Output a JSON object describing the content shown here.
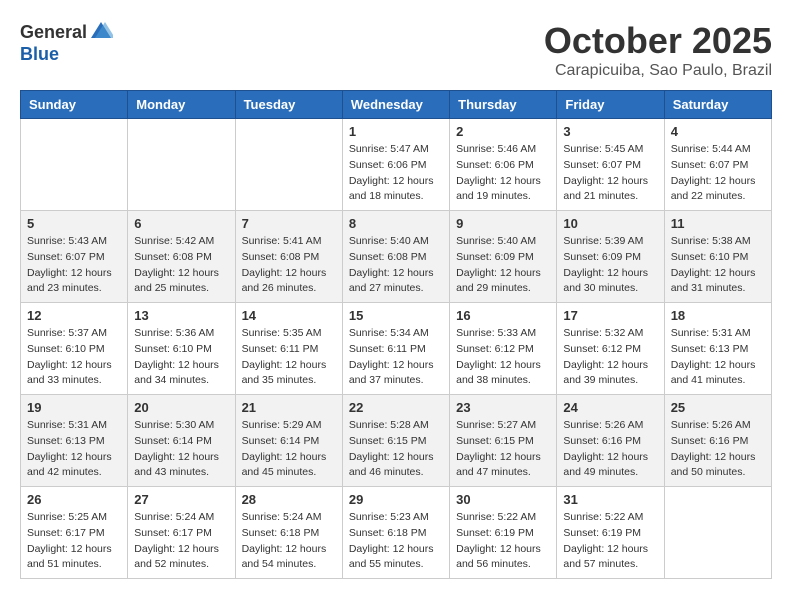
{
  "header": {
    "logo_general": "General",
    "logo_blue": "Blue",
    "month_title": "October 2025",
    "location": "Carapicuiba, Sao Paulo, Brazil"
  },
  "days_of_week": [
    "Sunday",
    "Monday",
    "Tuesday",
    "Wednesday",
    "Thursday",
    "Friday",
    "Saturday"
  ],
  "weeks": [
    [
      {
        "day": "",
        "info": ""
      },
      {
        "day": "",
        "info": ""
      },
      {
        "day": "",
        "info": ""
      },
      {
        "day": "1",
        "info": "Sunrise: 5:47 AM\nSunset: 6:06 PM\nDaylight: 12 hours and 18 minutes."
      },
      {
        "day": "2",
        "info": "Sunrise: 5:46 AM\nSunset: 6:06 PM\nDaylight: 12 hours and 19 minutes."
      },
      {
        "day": "3",
        "info": "Sunrise: 5:45 AM\nSunset: 6:07 PM\nDaylight: 12 hours and 21 minutes."
      },
      {
        "day": "4",
        "info": "Sunrise: 5:44 AM\nSunset: 6:07 PM\nDaylight: 12 hours and 22 minutes."
      }
    ],
    [
      {
        "day": "5",
        "info": "Sunrise: 5:43 AM\nSunset: 6:07 PM\nDaylight: 12 hours and 23 minutes."
      },
      {
        "day": "6",
        "info": "Sunrise: 5:42 AM\nSunset: 6:08 PM\nDaylight: 12 hours and 25 minutes."
      },
      {
        "day": "7",
        "info": "Sunrise: 5:41 AM\nSunset: 6:08 PM\nDaylight: 12 hours and 26 minutes."
      },
      {
        "day": "8",
        "info": "Sunrise: 5:40 AM\nSunset: 6:08 PM\nDaylight: 12 hours and 27 minutes."
      },
      {
        "day": "9",
        "info": "Sunrise: 5:40 AM\nSunset: 6:09 PM\nDaylight: 12 hours and 29 minutes."
      },
      {
        "day": "10",
        "info": "Sunrise: 5:39 AM\nSunset: 6:09 PM\nDaylight: 12 hours and 30 minutes."
      },
      {
        "day": "11",
        "info": "Sunrise: 5:38 AM\nSunset: 6:10 PM\nDaylight: 12 hours and 31 minutes."
      }
    ],
    [
      {
        "day": "12",
        "info": "Sunrise: 5:37 AM\nSunset: 6:10 PM\nDaylight: 12 hours and 33 minutes."
      },
      {
        "day": "13",
        "info": "Sunrise: 5:36 AM\nSunset: 6:10 PM\nDaylight: 12 hours and 34 minutes."
      },
      {
        "day": "14",
        "info": "Sunrise: 5:35 AM\nSunset: 6:11 PM\nDaylight: 12 hours and 35 minutes."
      },
      {
        "day": "15",
        "info": "Sunrise: 5:34 AM\nSunset: 6:11 PM\nDaylight: 12 hours and 37 minutes."
      },
      {
        "day": "16",
        "info": "Sunrise: 5:33 AM\nSunset: 6:12 PM\nDaylight: 12 hours and 38 minutes."
      },
      {
        "day": "17",
        "info": "Sunrise: 5:32 AM\nSunset: 6:12 PM\nDaylight: 12 hours and 39 minutes."
      },
      {
        "day": "18",
        "info": "Sunrise: 5:31 AM\nSunset: 6:13 PM\nDaylight: 12 hours and 41 minutes."
      }
    ],
    [
      {
        "day": "19",
        "info": "Sunrise: 5:31 AM\nSunset: 6:13 PM\nDaylight: 12 hours and 42 minutes."
      },
      {
        "day": "20",
        "info": "Sunrise: 5:30 AM\nSunset: 6:14 PM\nDaylight: 12 hours and 43 minutes."
      },
      {
        "day": "21",
        "info": "Sunrise: 5:29 AM\nSunset: 6:14 PM\nDaylight: 12 hours and 45 minutes."
      },
      {
        "day": "22",
        "info": "Sunrise: 5:28 AM\nSunset: 6:15 PM\nDaylight: 12 hours and 46 minutes."
      },
      {
        "day": "23",
        "info": "Sunrise: 5:27 AM\nSunset: 6:15 PM\nDaylight: 12 hours and 47 minutes."
      },
      {
        "day": "24",
        "info": "Sunrise: 5:26 AM\nSunset: 6:16 PM\nDaylight: 12 hours and 49 minutes."
      },
      {
        "day": "25",
        "info": "Sunrise: 5:26 AM\nSunset: 6:16 PM\nDaylight: 12 hours and 50 minutes."
      }
    ],
    [
      {
        "day": "26",
        "info": "Sunrise: 5:25 AM\nSunset: 6:17 PM\nDaylight: 12 hours and 51 minutes."
      },
      {
        "day": "27",
        "info": "Sunrise: 5:24 AM\nSunset: 6:17 PM\nDaylight: 12 hours and 52 minutes."
      },
      {
        "day": "28",
        "info": "Sunrise: 5:24 AM\nSunset: 6:18 PM\nDaylight: 12 hours and 54 minutes."
      },
      {
        "day": "29",
        "info": "Sunrise: 5:23 AM\nSunset: 6:18 PM\nDaylight: 12 hours and 55 minutes."
      },
      {
        "day": "30",
        "info": "Sunrise: 5:22 AM\nSunset: 6:19 PM\nDaylight: 12 hours and 56 minutes."
      },
      {
        "day": "31",
        "info": "Sunrise: 5:22 AM\nSunset: 6:19 PM\nDaylight: 12 hours and 57 minutes."
      },
      {
        "day": "",
        "info": ""
      }
    ]
  ]
}
